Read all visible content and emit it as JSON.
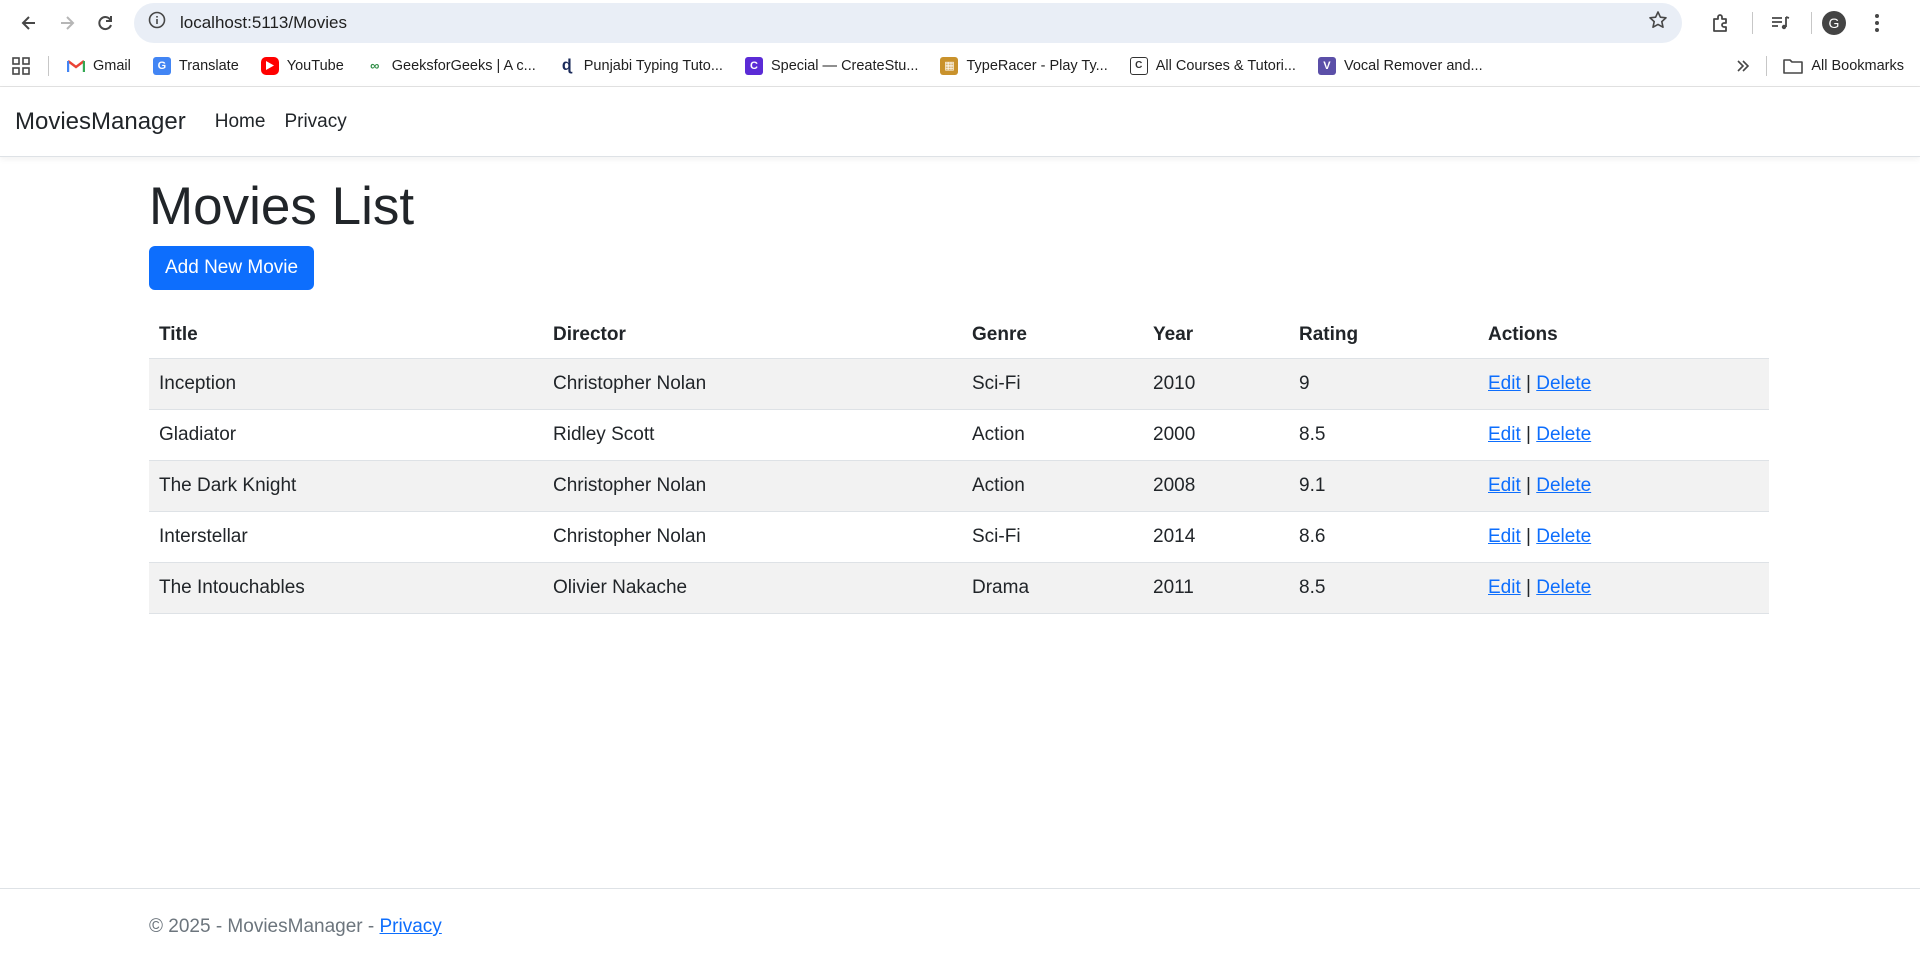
{
  "browser": {
    "url": "localhost:5113/Movies",
    "avatar_letter": "G",
    "bookmarks": [
      {
        "label": "Gmail",
        "icon": "gmail-icon"
      },
      {
        "label": "Translate",
        "icon": "translate-icon"
      },
      {
        "label": "YouTube",
        "icon": "youtube-icon"
      },
      {
        "label": "GeeksforGeeks | A c...",
        "icon": "geeksforgeeks-icon"
      },
      {
        "label": "Punjabi Typing Tuto...",
        "icon": "punjabi-typing-icon"
      },
      {
        "label": "Special — CreateStu...",
        "icon": "createstudio-icon"
      },
      {
        "label": "TypeRacer - Play Ty...",
        "icon": "typeracer-icon"
      },
      {
        "label": "All Courses & Tutori...",
        "icon": "courses-icon"
      },
      {
        "label": "Vocal Remover and...",
        "icon": "vocal-remover-icon"
      }
    ],
    "all_bookmarks": "All Bookmarks"
  },
  "site": {
    "brand": "MoviesManager",
    "nav": [
      "Home",
      "Privacy"
    ]
  },
  "main": {
    "heading": "Movies List",
    "add_button": "Add New Movie",
    "columns": [
      "Title",
      "Director",
      "Genre",
      "Year",
      "Rating",
      "Actions"
    ],
    "rows": [
      {
        "title": "Inception",
        "director": "Christopher Nolan",
        "genre": "Sci-Fi",
        "year": "2010",
        "rating": "9"
      },
      {
        "title": "Gladiator",
        "director": "Ridley Scott",
        "genre": "Action",
        "year": "2000",
        "rating": "8.5"
      },
      {
        "title": "The Dark Knight",
        "director": "Christopher Nolan",
        "genre": "Action",
        "year": "2008",
        "rating": "9.1"
      },
      {
        "title": "Interstellar",
        "director": "Christopher Nolan",
        "genre": "Sci-Fi",
        "year": "2014",
        "rating": "8.6"
      },
      {
        "title": "The Intouchables",
        "director": "Olivier Nakache",
        "genre": "Drama",
        "year": "2011",
        "rating": "8.5"
      }
    ],
    "edit_label": "Edit",
    "separator": "|",
    "delete_label": "Delete"
  },
  "footer": {
    "text": "© 2025 - MoviesManager - ",
    "privacy_link": "Privacy"
  },
  "colors": {
    "primary": "#0d6efd",
    "stripe": "#f2f2f2",
    "omnibox": "#e9eef6"
  }
}
